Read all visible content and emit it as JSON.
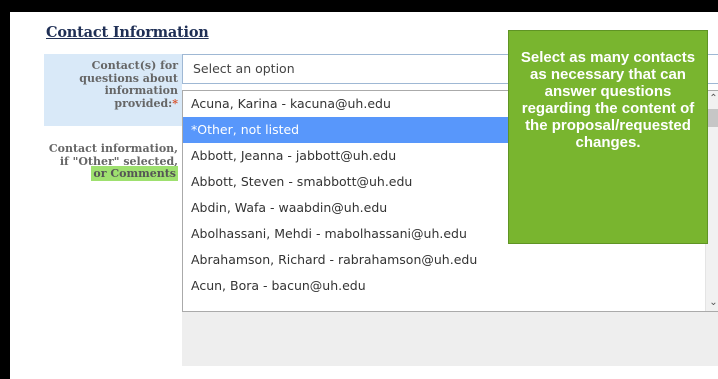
{
  "section_title": "Contact Information",
  "fields": {
    "contacts": {
      "label": "Contact(s) for questions about information provided:",
      "required_mark": "*",
      "placeholder": "Select an option"
    },
    "info": {
      "label": "Contact information, if \"Other\" selected,",
      "highlight": "or Comments"
    }
  },
  "dropdown": {
    "options": [
      "Acuna, Karina - kacuna@uh.edu",
      "*Other, not listed",
      "Abbott, Jeanna - jabbott@uh.edu",
      "Abbott, Steven - smabbott@uh.edu",
      "Abdin, Wafa - waabdin@uh.edu",
      "Abolhassani, Mehdi - mabolhassani@uh.edu",
      "Abrahamson, Richard - rabrahamson@uh.edu",
      "Acun, Bora - bacun@uh.edu"
    ],
    "selected_index": 1
  },
  "callout_text": "Select as many contacts as necessary that can answer questions regarding the content of the proposal/requested changes.",
  "colors": {
    "callout_bg": "#79b52f",
    "selected_option_bg": "#5897fb",
    "label_bg": "#d9e9f8",
    "highlight": "#9ee06f",
    "required": "#d9532c"
  },
  "icons": {
    "scroll_up": "chevron-up-icon",
    "scroll_down": "chevron-down-icon"
  }
}
